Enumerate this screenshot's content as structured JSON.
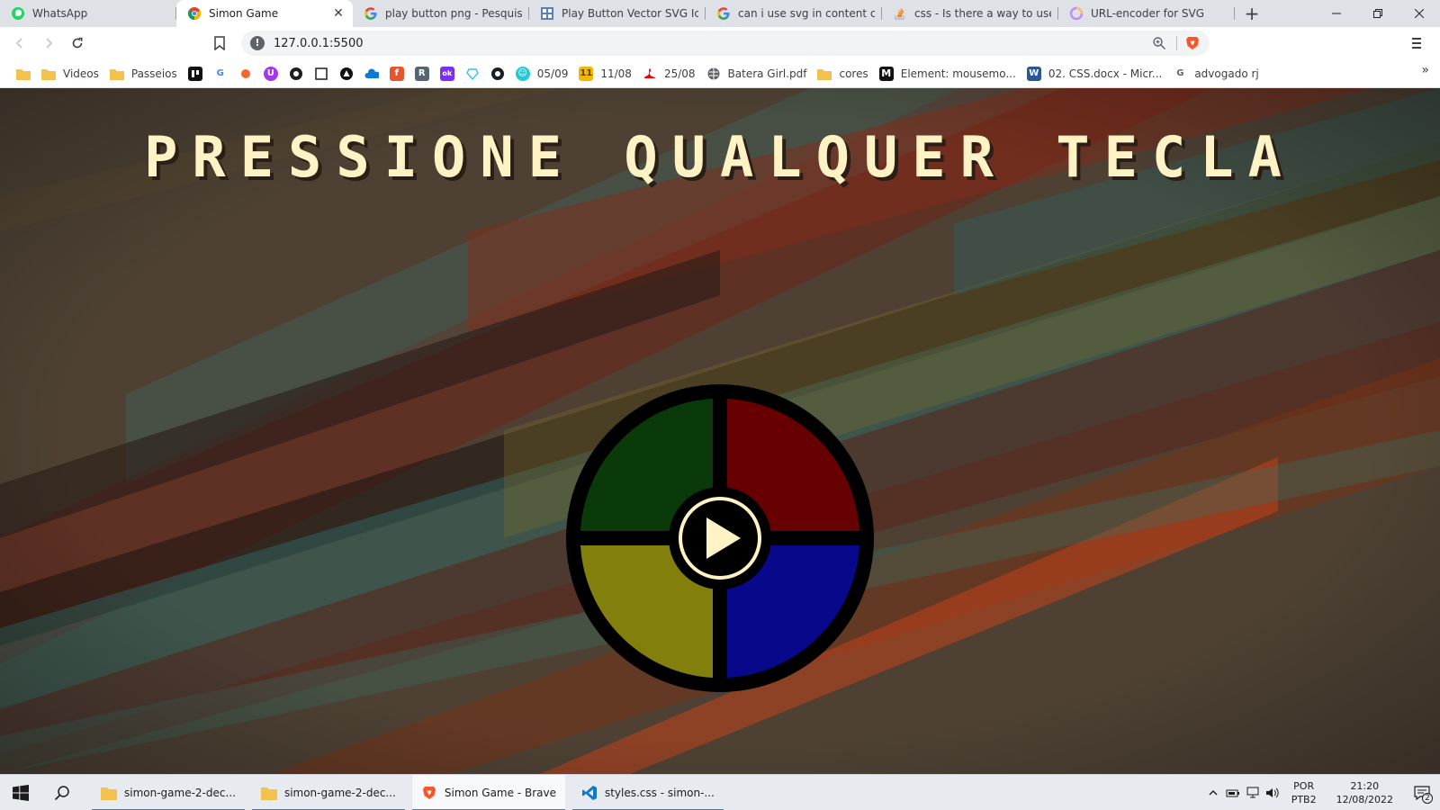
{
  "browser": {
    "tabs": [
      {
        "title": "WhatsApp",
        "icon": "whatsapp-icon",
        "active": false
      },
      {
        "title": "Simon Game",
        "icon": "chrome-icon",
        "active": true
      },
      {
        "title": "play button png - Pesquisa Go",
        "icon": "google-icon",
        "active": false
      },
      {
        "title": "Play Button Vector SVG Icon (",
        "icon": "svgrepo-icon",
        "active": false
      },
      {
        "title": "can i use svg in content css - P",
        "icon": "google-icon",
        "active": false
      },
      {
        "title": "css - Is there a way to use SVG",
        "icon": "stackoverflow-icon",
        "active": false
      },
      {
        "title": "URL-encoder for SVG",
        "icon": "circle-icon",
        "active": false
      }
    ],
    "new_tab_symbol": "+",
    "url": "127.0.0.1:5500",
    "bookmarks": [
      {
        "label": "",
        "icon": "folder-icon"
      },
      {
        "label": "Videos",
        "icon": "folder-icon"
      },
      {
        "label": "Passeios",
        "icon": "folder-icon"
      },
      {
        "label": "",
        "icon": "trello-icon"
      },
      {
        "label": "",
        "icon": "google-icon"
      },
      {
        "label": "",
        "icon": "sun-icon"
      },
      {
        "label": "",
        "icon": "udemy-icon"
      },
      {
        "label": "",
        "icon": "github-icon"
      },
      {
        "label": "",
        "icon": "square-icon"
      },
      {
        "label": "",
        "icon": "triangle-icon"
      },
      {
        "label": "",
        "icon": "onedrive-icon"
      },
      {
        "label": "",
        "icon": "f-icon"
      },
      {
        "label": "",
        "icon": "r-icon"
      },
      {
        "label": "",
        "icon": "ok-icon"
      },
      {
        "label": "",
        "icon": "heart-icon"
      },
      {
        "label": "",
        "icon": "github-icon"
      },
      {
        "label": "05/09",
        "icon": "smile-icon"
      },
      {
        "label": "11/08",
        "icon": "calendar-icon"
      },
      {
        "label": "25/08",
        "icon": "santander-icon"
      },
      {
        "label": "Batera Girl.pdf",
        "icon": "globe-icon"
      },
      {
        "label": "cores",
        "icon": "folder-icon"
      },
      {
        "label": "Element: mousemo...",
        "icon": "mdn-icon"
      },
      {
        "label": "02. CSS.docx - Micr...",
        "icon": "word-icon"
      },
      {
        "label": "advogado rj",
        "icon": "google-icon"
      }
    ]
  },
  "page": {
    "headline": "PRESSIONE QUALQUER TECLA",
    "simon": {
      "colors": {
        "green": "#0b3a0a",
        "red": "#670000",
        "yellow": "#837f0c",
        "blue": "#08088a",
        "ring": "#000000",
        "play": "#fff2c4"
      }
    }
  },
  "taskbar": {
    "apps": [
      {
        "label": "simon-game-2-dec...",
        "icon": "folder-icon",
        "active": false
      },
      {
        "label": "simon-game-2-dec...",
        "icon": "folder-icon",
        "active": false
      },
      {
        "label": "Simon Game - Brave",
        "icon": "brave-icon",
        "active": true
      },
      {
        "label": "styles.css - simon-...",
        "icon": "vscode-icon",
        "active": false
      }
    ],
    "language": "POR",
    "layout": "PTB2",
    "time": "21:20",
    "date": "12/08/2022",
    "notifications": "2"
  }
}
